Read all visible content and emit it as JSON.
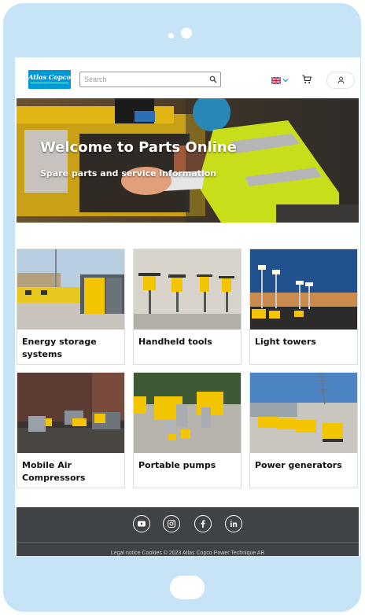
{
  "brand": {
    "name": "Atlas Copco",
    "logo_color": "#0099d8"
  },
  "search": {
    "placeholder": "Search",
    "icon": "search-icon"
  },
  "header": {
    "language_icon": "uk-flag-icon",
    "cart_icon": "cart-icon",
    "account_icon": "user-icon"
  },
  "hero": {
    "title": "Welcome to Parts Online",
    "subtitle": "Spare parts and service information"
  },
  "categories": [
    {
      "label": "Energy storage systems"
    },
    {
      "label": "Handheld tools"
    },
    {
      "label": "Light towers"
    },
    {
      "label": "Mobile Air Compressors"
    },
    {
      "label": "Portable pumps"
    },
    {
      "label": "Power generators"
    }
  ],
  "footer": {
    "social": [
      "youtube-icon",
      "instagram-icon",
      "facebook-icon",
      "linkedin-icon"
    ],
    "legal_text": "Legal notice   Cookies   © 2023 Atlas Copco Power Technique AB"
  },
  "colors": {
    "accent_yellow": "#f2c500",
    "footer_bg": "#3f4346",
    "device_frame": "#c6e4f6"
  }
}
